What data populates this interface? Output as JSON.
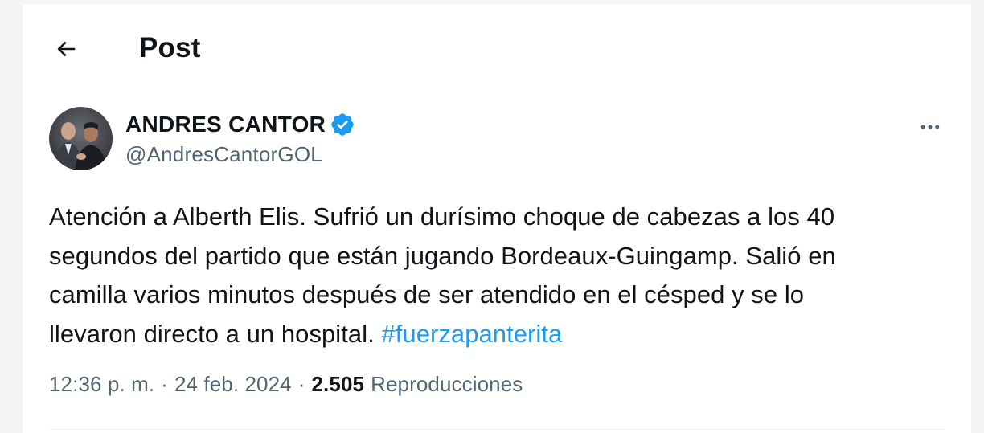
{
  "header": {
    "title": "Post",
    "back_icon": "arrow-left-icon"
  },
  "author": {
    "display_name": "ANDRES CANTOR",
    "handle": "@AndresCantorGOL",
    "verified_icon": "verified-badge-icon",
    "verified_color": "#1d9bf0"
  },
  "post": {
    "text": "Atención a Alberth Elis. Sufrió un durísimo choque de cabezas a los 40\nsegundos del partido que están jugando Bordeaux-Guingamp. Salió en\ncamilla varios minutos después de ser atendido en el césped y se lo\nllevaron directo a un hospital. ",
    "hashtag": "#fuerzapanterita",
    "hashtag_color": "#1d9bf0"
  },
  "meta": {
    "time": "12:36 p. m.",
    "separator": "·",
    "date": "24 feb. 2024",
    "views_count": "2.505",
    "views_label": "Reproducciones"
  },
  "more_icon": "more-horizontal-icon"
}
